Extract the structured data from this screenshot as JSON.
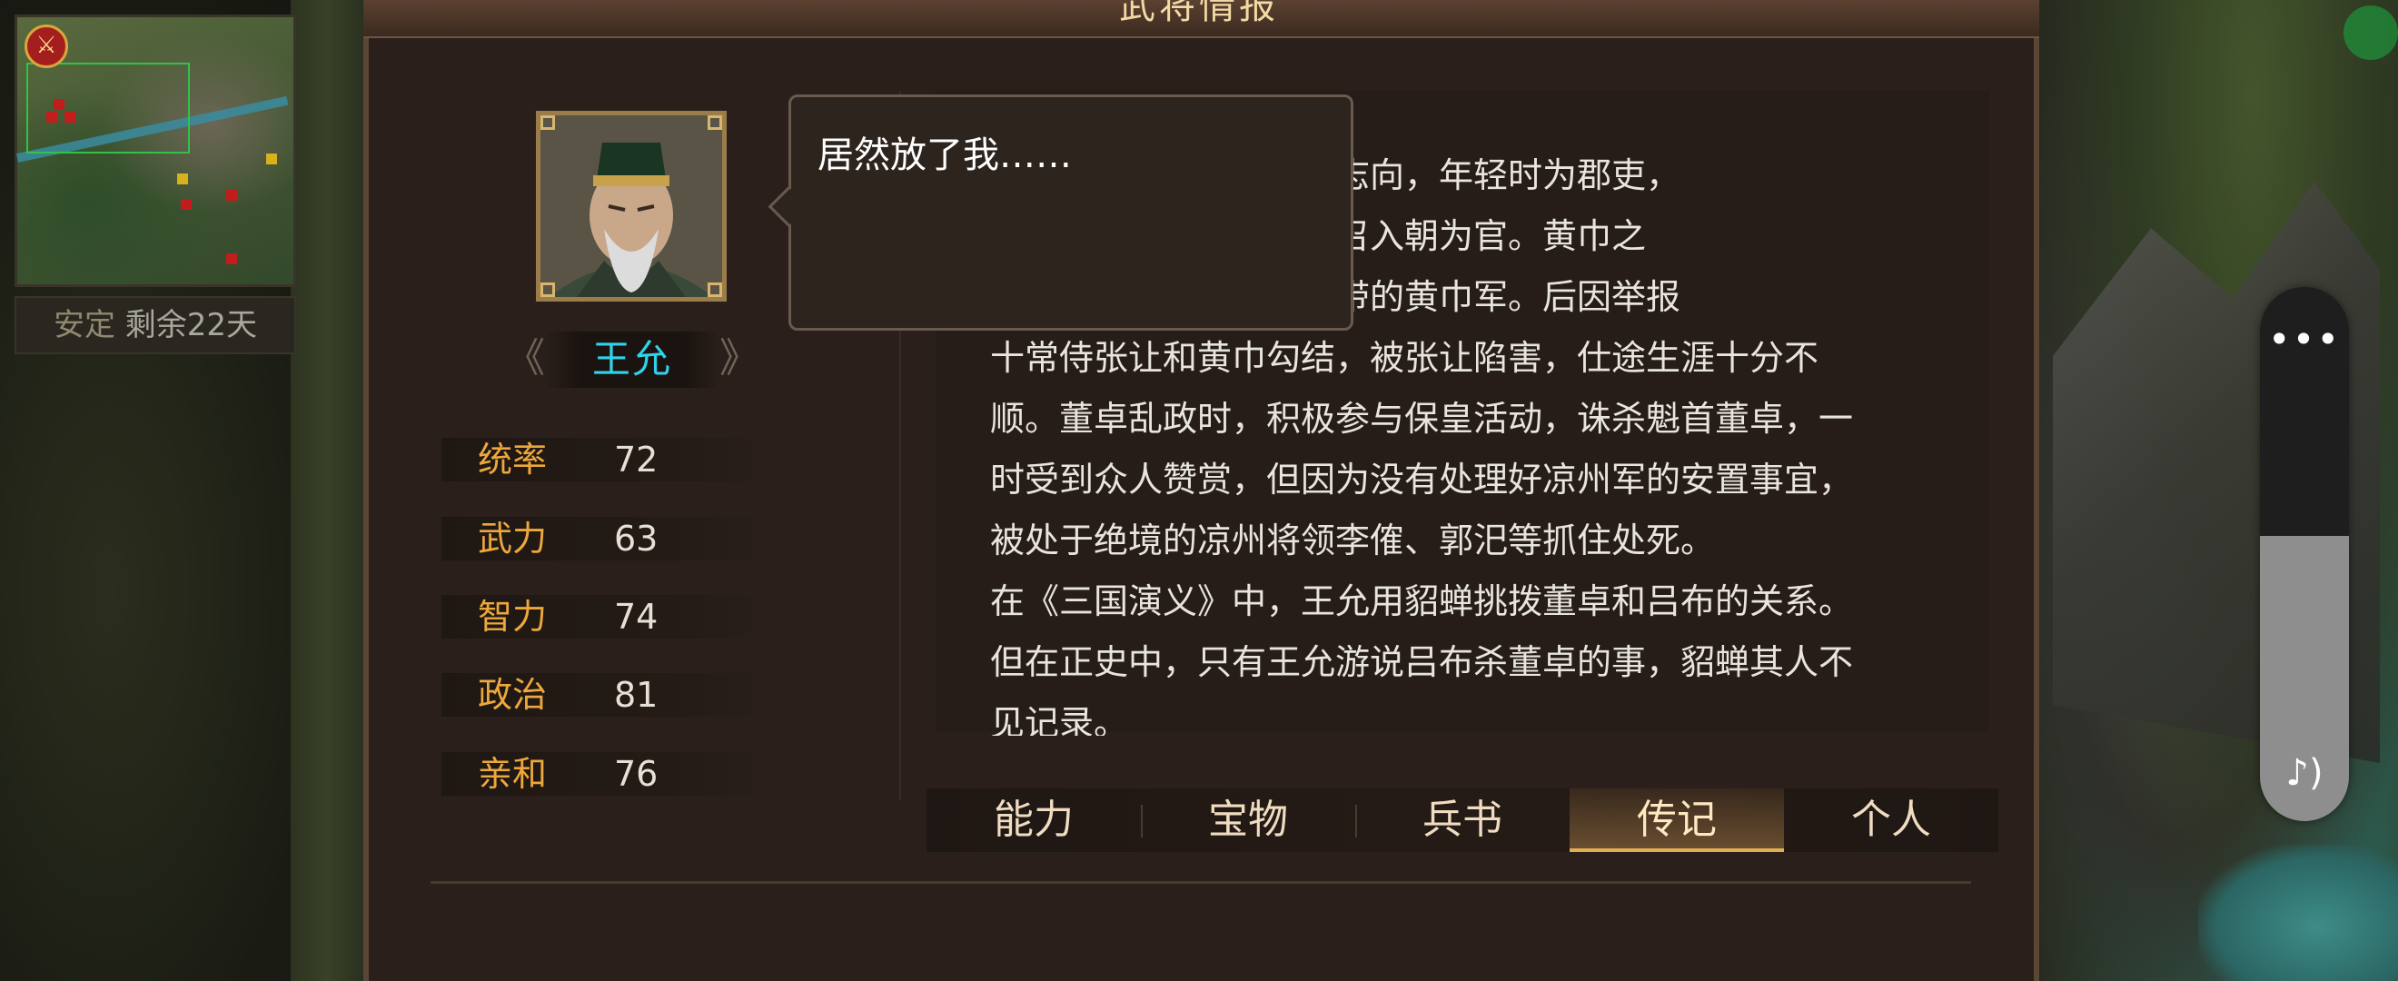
{
  "panel": {
    "title": "武将情报"
  },
  "minimap": {
    "badge": "⚔"
  },
  "status": {
    "label": "安定",
    "value": "剩余22天"
  },
  "general": {
    "name": "王允",
    "prev_arrow": "《",
    "next_arrow": "》"
  },
  "stats": [
    {
      "label": "统率",
      "value": "72"
    },
    {
      "label": "武力",
      "value": "63"
    },
    {
      "label": "智力",
      "value": "74"
    },
    {
      "label": "政治",
      "value": "81"
    },
    {
      "label": "亲和",
      "value": "76"
    }
  ],
  "bubble": {
    "text": "居然放了我……"
  },
  "biography": {
    "lines": [
      "王允出身名门，少有大志向，年轻时为郡吏，",
      "受到朝廷的注意，被征召入朝为官。黄巾之",
      "乱时，率军击溃豫州一带的黄巾军。后因举报",
      "十常侍张让和黄巾勾结，被张让陷害，仕途生涯十分不",
      "顺。董卓乱政时，积极参与保皇活动，诛杀魁首董卓，一",
      "时受到众人赞赏，但因为没有处理好凉州军的安置事宜，",
      "被处于绝境的凉州将领李傕、郭汜等抓住处死。",
      "在《三国演义》中，王允用貂蝉挑拨董卓和吕布的关系。",
      "但在正史中，只有王允游说吕布杀董卓的事，貂蝉其人不",
      "见记录。"
    ]
  },
  "tabs": [
    {
      "label": "能力"
    },
    {
      "label": "宝物"
    },
    {
      "label": "兵书"
    },
    {
      "label": "传记"
    },
    {
      "label": "个人"
    }
  ],
  "side_control": {
    "more_icon": "•••",
    "sound_icon": "♪)"
  },
  "colors": {
    "stat_label": "#eda83c",
    "name": "#2fd3ea",
    "panel_bg": "#2a1f1a"
  }
}
